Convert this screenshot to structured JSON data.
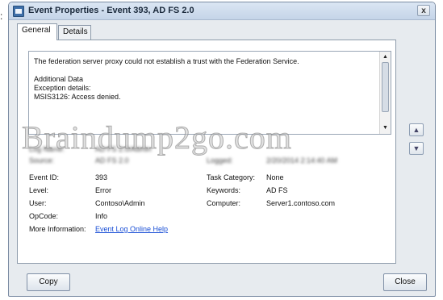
{
  "window": {
    "title": "Event Properties - Event 393, AD FS 2.0",
    "close_glyph": "x"
  },
  "stray_mark": ":",
  "tabs": [
    {
      "label": "General"
    },
    {
      "label": "Details"
    }
  ],
  "description": {
    "text": "The federation server proxy could not establish a trust with the Federation Service.\n\nAdditional Data\nException details:\nMSIS3126: Access denied."
  },
  "properties": {
    "log_name_label": "Log Name:",
    "log_name_value": "AD FS 2.0/Admin",
    "source_label": "Source:",
    "source_value": "AD FS 2.0",
    "logged_label": "Logged:",
    "logged_value": "2/20/2014 2:14:40 AM",
    "event_id_label": "Event ID:",
    "event_id_value": "393",
    "task_category_label": "Task Category:",
    "task_category_value": "None",
    "level_label": "Level:",
    "level_value": "Error",
    "keywords_label": "Keywords:",
    "keywords_value": "AD FS",
    "user_label": "User:",
    "user_value": "Contoso\\Admin",
    "computer_label": "Computer:",
    "computer_value": "Server1.contoso.com",
    "opcode_label": "OpCode:",
    "opcode_value": "Info",
    "more_info_label": "More Information:",
    "more_info_link": "Event Log Online Help"
  },
  "watermark": "Braindump2go.com",
  "buttons": {
    "copy": "Copy",
    "close": "Close",
    "prev_glyph": "▲",
    "next_glyph": "▼"
  },
  "scroll": {
    "up": "▲",
    "down": "▼"
  },
  "colors": {
    "link": "#1a4fd6",
    "title_bar": "#c4d4e8"
  }
}
